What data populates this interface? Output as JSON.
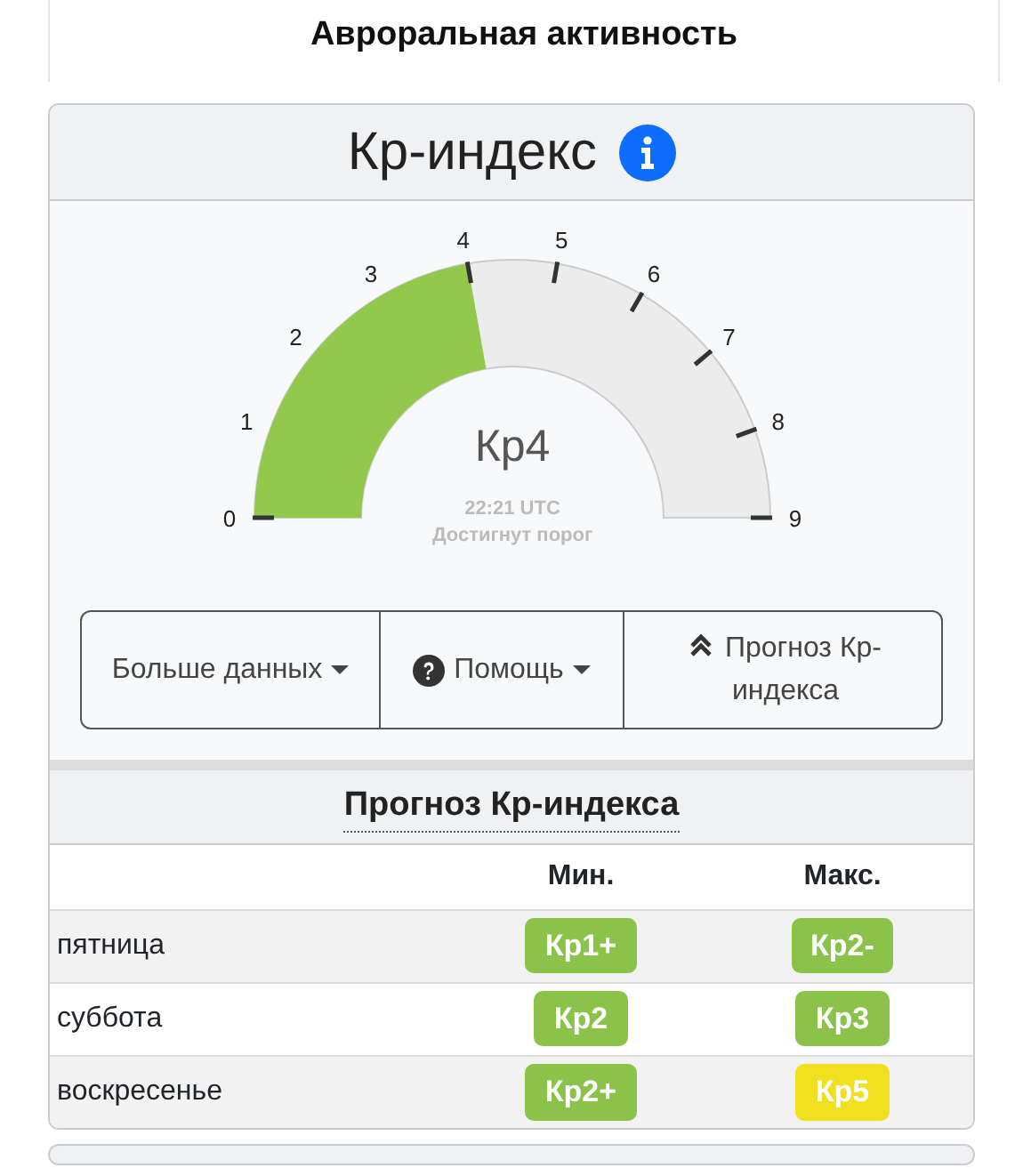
{
  "page_title": "Авроральная активность",
  "card": {
    "title": "Кр-индекс"
  },
  "gauge": {
    "level": 0.4444,
    "ticks": [
      "0",
      "1",
      "2",
      "3",
      "4",
      "5",
      "6",
      "7",
      "8",
      "9"
    ],
    "value": "Кр4",
    "time": "22:21 UTC",
    "status": "Достигнут порог"
  },
  "buttons": [
    {
      "label": "Больше данных",
      "kind": "dropdown"
    },
    {
      "label": "Помощь",
      "kind": "help-dropdown"
    },
    {
      "label": "Прогноз Кр-индекса",
      "kind": "link"
    }
  ],
  "forecast": {
    "title": "Прогноз Кр-индекса",
    "columns": [
      "Мин.",
      "Макс."
    ],
    "rows": [
      {
        "day": "пятница",
        "min": {
          "text": "Кр1+",
          "color": "#8bc34a"
        },
        "max": {
          "text": "Кр2-",
          "color": "#8bc34a"
        }
      },
      {
        "day": "суббота",
        "min": {
          "text": "Кр2",
          "color": "#8bc34a"
        },
        "max": {
          "text": "Кр3",
          "color": "#8bc34a"
        }
      },
      {
        "day": "воскресенье",
        "min": {
          "text": "Кр2+",
          "color": "#8bc34a"
        },
        "max": {
          "text": "Кр5",
          "color": "#f0e020"
        }
      }
    ]
  }
}
